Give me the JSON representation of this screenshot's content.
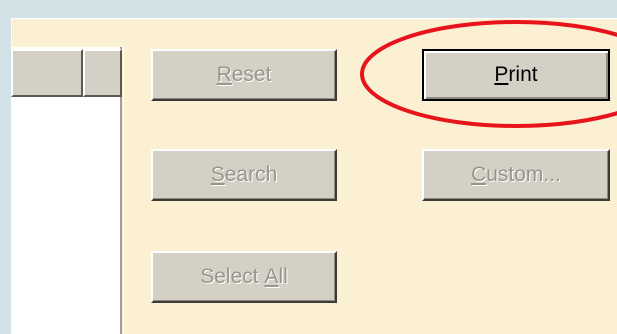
{
  "buttons": {
    "reset": {
      "mnemonic": "R",
      "rest": "eset",
      "enabled": false
    },
    "print": {
      "mnemonic": "P",
      "rest": "rint",
      "enabled": true
    },
    "search": {
      "mnemonic": "S",
      "rest": "earch",
      "enabled": false
    },
    "custom": {
      "mnemonic": "C",
      "rest": "ustom...",
      "enabled": false
    },
    "select_all": {
      "prefix": "Select ",
      "mnemonic": "A",
      "rest": "ll",
      "enabled": false
    }
  },
  "colors": {
    "panel_background": "#fbf1d2",
    "outer_background": "#d3e2e6",
    "button_face": "#d5d0c6",
    "highlight_ellipse": "#e8141b"
  }
}
